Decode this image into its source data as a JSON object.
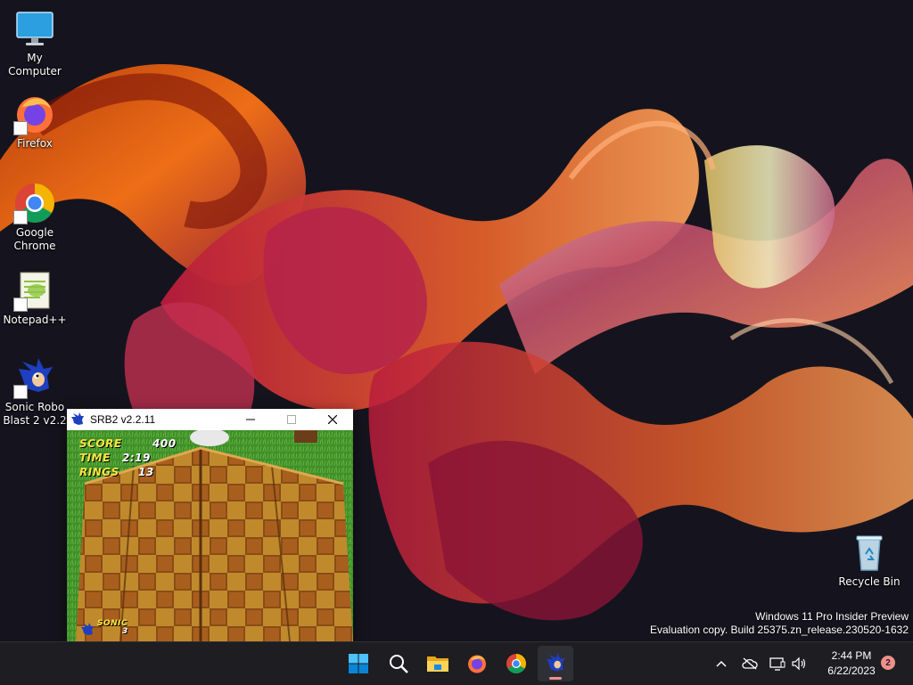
{
  "desktop": {
    "icons": [
      {
        "label": "My Computer"
      },
      {
        "label": "Firefox"
      },
      {
        "label": "Google Chrome"
      },
      {
        "label": "Notepad++"
      },
      {
        "label": "Sonic Robo Blast 2 v2.2"
      },
      {
        "label": "Recycle Bin"
      }
    ]
  },
  "game_window": {
    "title": "SRB2 v2.2.11",
    "hud": {
      "score_label": "SCORE",
      "score": "400",
      "time_label": "TIME",
      "time": "2:19",
      "rings_label": "RINGS",
      "rings": "13",
      "lives_name": "SONIC",
      "lives": "3"
    }
  },
  "watermark": {
    "line1": "Windows 11 Pro Insider Preview",
    "line2": "Evaluation copy. Build 25375.zn_release.230520-1632"
  },
  "taskbar": {
    "apps": [
      "start-icon",
      "search-icon",
      "file-explorer-icon",
      "firefox-icon",
      "chrome-icon",
      "srb2-icon"
    ],
    "clock": {
      "time": "2:44 PM",
      "date": "6/22/2023"
    },
    "notification_count": "2"
  },
  "colors": {
    "taskbar": "#1d1d22",
    "accent": "#0078d4",
    "hud_label": "#f7e640"
  }
}
